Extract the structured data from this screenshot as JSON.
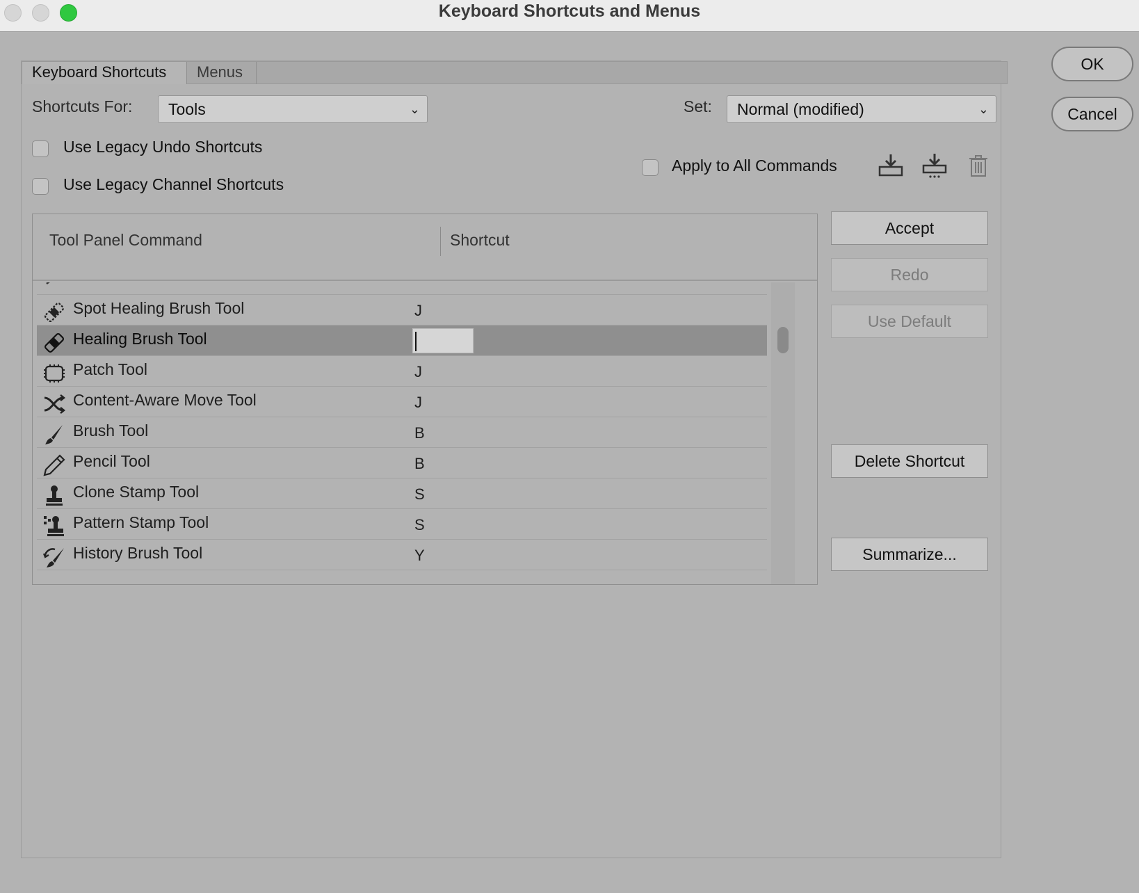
{
  "window": {
    "title": "Keyboard Shortcuts and Menus"
  },
  "dialog_buttons": {
    "ok": "OK",
    "cancel": "Cancel"
  },
  "tabs": [
    {
      "label": "Keyboard Shortcuts",
      "active": true
    },
    {
      "label": "Menus",
      "active": false
    }
  ],
  "shortcuts_for": {
    "label": "Shortcuts For:",
    "value": "Tools"
  },
  "set": {
    "label": "Set:",
    "value": "Normal (modified)"
  },
  "options": {
    "legacy_undo": {
      "label": "Use Legacy Undo Shortcuts",
      "checked": false
    },
    "legacy_channel": {
      "label": "Use Legacy Channel Shortcuts",
      "checked": false
    },
    "apply_all": {
      "label": "Apply to All Commands",
      "checked": false
    }
  },
  "table": {
    "headers": {
      "command": "Tool Panel Command",
      "shortcut": "Shortcut"
    },
    "rows": [
      {
        "icon": "spot-healing-brush-icon",
        "name": "Spot Healing Brush Tool",
        "shortcut": "J",
        "selected": false
      },
      {
        "icon": "healing-brush-icon",
        "name": "Healing Brush Tool",
        "shortcut": "",
        "selected": true
      },
      {
        "icon": "patch-icon",
        "name": "Patch Tool",
        "shortcut": "J",
        "selected": false
      },
      {
        "icon": "content-aware-move-icon",
        "name": "Content-Aware Move Tool",
        "shortcut": "J",
        "selected": false
      },
      {
        "icon": "brush-icon",
        "name": "Brush Tool",
        "shortcut": "B",
        "selected": false
      },
      {
        "icon": "pencil-icon",
        "name": "Pencil Tool",
        "shortcut": "B",
        "selected": false
      },
      {
        "icon": "clone-stamp-icon",
        "name": "Clone Stamp Tool",
        "shortcut": "S",
        "selected": false
      },
      {
        "icon": "pattern-stamp-icon",
        "name": "Pattern Stamp Tool",
        "shortcut": "S",
        "selected": false
      },
      {
        "icon": "history-brush-icon",
        "name": "History Brush Tool",
        "shortcut": "Y",
        "selected": false
      }
    ]
  },
  "side_buttons": {
    "accept": "Accept",
    "redo": "Redo",
    "use_default": "Use Default",
    "delete_shortcut": "Delete Shortcut",
    "summarize": "Summarize..."
  },
  "colors": {
    "background": "#b3b3b3",
    "selected_row": "#8f8f8f",
    "maximize": "#2fc840"
  }
}
